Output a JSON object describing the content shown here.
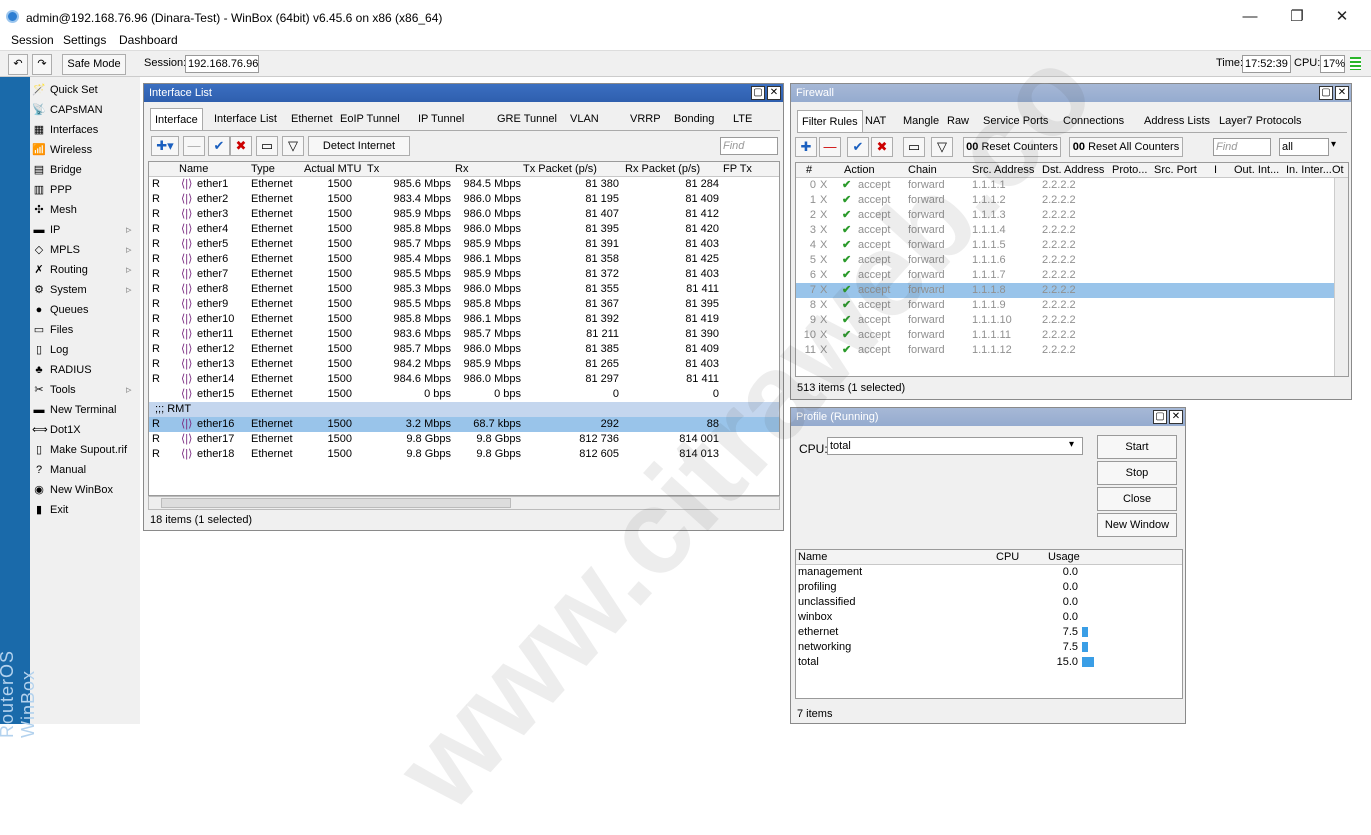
{
  "titlebar": {
    "title": "admin@192.168.76.96 (Dinara-Test) - WinBox (64bit) v6.45.6 on x86 (x86_64)",
    "min": "—",
    "max": "❐",
    "close": "✕"
  },
  "menu": {
    "items": [
      "Session",
      "Settings",
      "Dashboard"
    ]
  },
  "toolbar": {
    "undo": "↶",
    "redo": "↷",
    "safe_mode": "Safe Mode",
    "session_label": "Session:",
    "session_value": "192.168.76.96",
    "time_label": "Time:",
    "time_value": "17:52:39",
    "cpu_label": "CPU:",
    "cpu_value": "17%"
  },
  "sidebar": {
    "brand": "RouterOS WinBox",
    "items": [
      {
        "label": "Quick Set",
        "icon": "🪄",
        "arrow": ""
      },
      {
        "label": "CAPsMAN",
        "icon": "📡",
        "arrow": ""
      },
      {
        "label": "Interfaces",
        "icon": "▦",
        "arrow": ""
      },
      {
        "label": "Wireless",
        "icon": "📶",
        "arrow": ""
      },
      {
        "label": "Bridge",
        "icon": "▤",
        "arrow": ""
      },
      {
        "label": "PPP",
        "icon": "▥",
        "arrow": ""
      },
      {
        "label": "Mesh",
        "icon": "✣",
        "arrow": ""
      },
      {
        "label": "IP",
        "icon": "▬",
        "arrow": "▹"
      },
      {
        "label": "MPLS",
        "icon": "◇",
        "arrow": "▹"
      },
      {
        "label": "Routing",
        "icon": "✗",
        "arrow": "▹"
      },
      {
        "label": "System",
        "icon": "⚙",
        "arrow": "▹"
      },
      {
        "label": "Queues",
        "icon": "●",
        "arrow": ""
      },
      {
        "label": "Files",
        "icon": "▭",
        "arrow": ""
      },
      {
        "label": "Log",
        "icon": "▯",
        "arrow": ""
      },
      {
        "label": "RADIUS",
        "icon": "♣",
        "arrow": ""
      },
      {
        "label": "Tools",
        "icon": "✂",
        "arrow": "▹"
      },
      {
        "label": "New Terminal",
        "icon": "▬",
        "arrow": ""
      },
      {
        "label": "Dot1X",
        "icon": "⟺",
        "arrow": ""
      },
      {
        "label": "Make Supout.rif",
        "icon": "▯",
        "arrow": ""
      },
      {
        "label": "Manual",
        "icon": "?",
        "arrow": ""
      },
      {
        "label": "New WinBox",
        "icon": "◉",
        "arrow": ""
      },
      {
        "label": "Exit",
        "icon": "▮",
        "arrow": ""
      }
    ]
  },
  "iface": {
    "title": "Interface List",
    "tabs": [
      "Interface",
      "Interface List",
      "Ethernet",
      "EoIP Tunnel",
      "IP Tunnel",
      "GRE Tunnel",
      "VLAN",
      "VRRP",
      "Bonding",
      "LTE"
    ],
    "detect": "Detect Internet",
    "find": "Find",
    "columns": [
      "Name",
      "Type",
      "Actual MTU",
      "Tx",
      "Rx",
      "Tx Packet (p/s)",
      "Rx Packet (p/s)",
      "FP Tx"
    ],
    "rows": [
      {
        "flag": "R",
        "name": "ether1",
        "type": "Ethernet",
        "mtu": "1500",
        "tx": "985.6 Mbps",
        "rx": "984.5 Mbps",
        "txp": "81 380",
        "rxp": "81 284"
      },
      {
        "flag": "R",
        "name": "ether2",
        "type": "Ethernet",
        "mtu": "1500",
        "tx": "983.4 Mbps",
        "rx": "986.0 Mbps",
        "txp": "81 195",
        "rxp": "81 409"
      },
      {
        "flag": "R",
        "name": "ether3",
        "type": "Ethernet",
        "mtu": "1500",
        "tx": "985.9 Mbps",
        "rx": "986.0 Mbps",
        "txp": "81 407",
        "rxp": "81 412"
      },
      {
        "flag": "R",
        "name": "ether4",
        "type": "Ethernet",
        "mtu": "1500",
        "tx": "985.8 Mbps",
        "rx": "986.0 Mbps",
        "txp": "81 395",
        "rxp": "81 420"
      },
      {
        "flag": "R",
        "name": "ether5",
        "type": "Ethernet",
        "mtu": "1500",
        "tx": "985.7 Mbps",
        "rx": "985.9 Mbps",
        "txp": "81 391",
        "rxp": "81 403"
      },
      {
        "flag": "R",
        "name": "ether6",
        "type": "Ethernet",
        "mtu": "1500",
        "tx": "985.4 Mbps",
        "rx": "986.1 Mbps",
        "txp": "81 358",
        "rxp": "81 425"
      },
      {
        "flag": "R",
        "name": "ether7",
        "type": "Ethernet",
        "mtu": "1500",
        "tx": "985.5 Mbps",
        "rx": "985.9 Mbps",
        "txp": "81 372",
        "rxp": "81 403"
      },
      {
        "flag": "R",
        "name": "ether8",
        "type": "Ethernet",
        "mtu": "1500",
        "tx": "985.3 Mbps",
        "rx": "986.0 Mbps",
        "txp": "81 355",
        "rxp": "81 411"
      },
      {
        "flag": "R",
        "name": "ether9",
        "type": "Ethernet",
        "mtu": "1500",
        "tx": "985.5 Mbps",
        "rx": "985.8 Mbps",
        "txp": "81 367",
        "rxp": "81 395"
      },
      {
        "flag": "R",
        "name": "ether10",
        "type": "Ethernet",
        "mtu": "1500",
        "tx": "985.8 Mbps",
        "rx": "986.1 Mbps",
        "txp": "81 392",
        "rxp": "81 419"
      },
      {
        "flag": "R",
        "name": "ether11",
        "type": "Ethernet",
        "mtu": "1500",
        "tx": "983.6 Mbps",
        "rx": "985.7 Mbps",
        "txp": "81 211",
        "rxp": "81 390"
      },
      {
        "flag": "R",
        "name": "ether12",
        "type": "Ethernet",
        "mtu": "1500",
        "tx": "985.7 Mbps",
        "rx": "986.0 Mbps",
        "txp": "81 385",
        "rxp": "81 409"
      },
      {
        "flag": "R",
        "name": "ether13",
        "type": "Ethernet",
        "mtu": "1500",
        "tx": "984.2 Mbps",
        "rx": "985.9 Mbps",
        "txp": "81 265",
        "rxp": "81 403"
      },
      {
        "flag": "R",
        "name": "ether14",
        "type": "Ethernet",
        "mtu": "1500",
        "tx": "984.6 Mbps",
        "rx": "986.0 Mbps",
        "txp": "81 297",
        "rxp": "81 411"
      },
      {
        "flag": "",
        "name": "ether15",
        "type": "Ethernet",
        "mtu": "1500",
        "tx": "0 bps",
        "rx": "0 bps",
        "txp": "0",
        "rxp": "0"
      },
      {
        "comment": ";;; RMT"
      },
      {
        "flag": "R",
        "name": "ether16",
        "type": "Ethernet",
        "mtu": "1500",
        "tx": "3.2 Mbps",
        "rx": "68.7 kbps",
        "txp": "292",
        "rxp": "88",
        "selected": true
      },
      {
        "flag": "R",
        "name": "ether17",
        "type": "Ethernet",
        "mtu": "1500",
        "tx": "9.8 Gbps",
        "rx": "9.8 Gbps",
        "txp": "812 736",
        "rxp": "814 001"
      },
      {
        "flag": "R",
        "name": "ether18",
        "type": "Ethernet",
        "mtu": "1500",
        "tx": "9.8 Gbps",
        "rx": "9.8 Gbps",
        "txp": "812 605",
        "rxp": "814 013"
      }
    ],
    "status": "18 items (1 selected)"
  },
  "firewall": {
    "title": "Firewall",
    "tabs": [
      "Filter Rules",
      "NAT",
      "Mangle",
      "Raw",
      "Service Ports",
      "Connections",
      "Address Lists",
      "Layer7 Protocols"
    ],
    "reset": "Reset Counters",
    "reset_all": "Reset All Counters",
    "oo": "00",
    "find": "Find",
    "filter_value": "all",
    "columns": [
      "#",
      "Action",
      "Chain",
      "Src. Address",
      "Dst. Address",
      "Proto...",
      "Src. Port",
      "I",
      "Out. Int...",
      "In. Inter...",
      "Ot"
    ],
    "rows": [
      {
        "n": "0",
        "flag": "X",
        "action": "accept",
        "chain": "forward",
        "src": "1.1.1.1",
        "dst": "2.2.2.2"
      },
      {
        "n": "1",
        "flag": "X",
        "action": "accept",
        "chain": "forward",
        "src": "1.1.1.2",
        "dst": "2.2.2.2"
      },
      {
        "n": "2",
        "flag": "X",
        "action": "accept",
        "chain": "forward",
        "src": "1.1.1.3",
        "dst": "2.2.2.2"
      },
      {
        "n": "3",
        "flag": "X",
        "action": "accept",
        "chain": "forward",
        "src": "1.1.1.4",
        "dst": "2.2.2.2"
      },
      {
        "n": "4",
        "flag": "X",
        "action": "accept",
        "chain": "forward",
        "src": "1.1.1.5",
        "dst": "2.2.2.2"
      },
      {
        "n": "5",
        "flag": "X",
        "action": "accept",
        "chain": "forward",
        "src": "1.1.1.6",
        "dst": "2.2.2.2"
      },
      {
        "n": "6",
        "flag": "X",
        "action": "accept",
        "chain": "forward",
        "src": "1.1.1.7",
        "dst": "2.2.2.2"
      },
      {
        "n": "7",
        "flag": "X",
        "action": "accept",
        "chain": "forward",
        "src": "1.1.1.8",
        "dst": "2.2.2.2",
        "selected": true
      },
      {
        "n": "8",
        "flag": "X",
        "action": "accept",
        "chain": "forward",
        "src": "1.1.1.9",
        "dst": "2.2.2.2"
      },
      {
        "n": "9",
        "flag": "X",
        "action": "accept",
        "chain": "forward",
        "src": "1.1.1.10",
        "dst": "2.2.2.2"
      },
      {
        "n": "10",
        "flag": "X",
        "action": "accept",
        "chain": "forward",
        "src": "1.1.1.11",
        "dst": "2.2.2.2"
      },
      {
        "n": "11",
        "flag": "X",
        "action": "accept",
        "chain": "forward",
        "src": "1.1.1.12",
        "dst": "2.2.2.2"
      }
    ],
    "status": "513 items (1 selected)"
  },
  "profile": {
    "title": "Profile (Running)",
    "cpu_label": "CPU:",
    "cpu_value": "total",
    "buttons": [
      "Start",
      "Stop",
      "Close",
      "New Window"
    ],
    "columns": [
      "Name",
      "CPU",
      "Usage"
    ],
    "rows": [
      {
        "name": "management",
        "usage": "0.0",
        "pct": 0
      },
      {
        "name": "profiling",
        "usage": "0.0",
        "pct": 0
      },
      {
        "name": "unclassified",
        "usage": "0.0",
        "pct": 0
      },
      {
        "name": "winbox",
        "usage": "0.0",
        "pct": 0
      },
      {
        "name": "ethernet",
        "usage": "7.5",
        "pct": 7.5
      },
      {
        "name": "networking",
        "usage": "7.5",
        "pct": 7.5
      },
      {
        "name": "total",
        "usage": "15.0",
        "pct": 15.0
      }
    ],
    "status": "7 items"
  },
  "watermark": "www.citraweb.co",
  "colors": {
    "selected": "#99c4ea",
    "title_active": "#3b6fc1",
    "usage_bar": "#3a9ee6",
    "accept": "#2a9a2a"
  }
}
